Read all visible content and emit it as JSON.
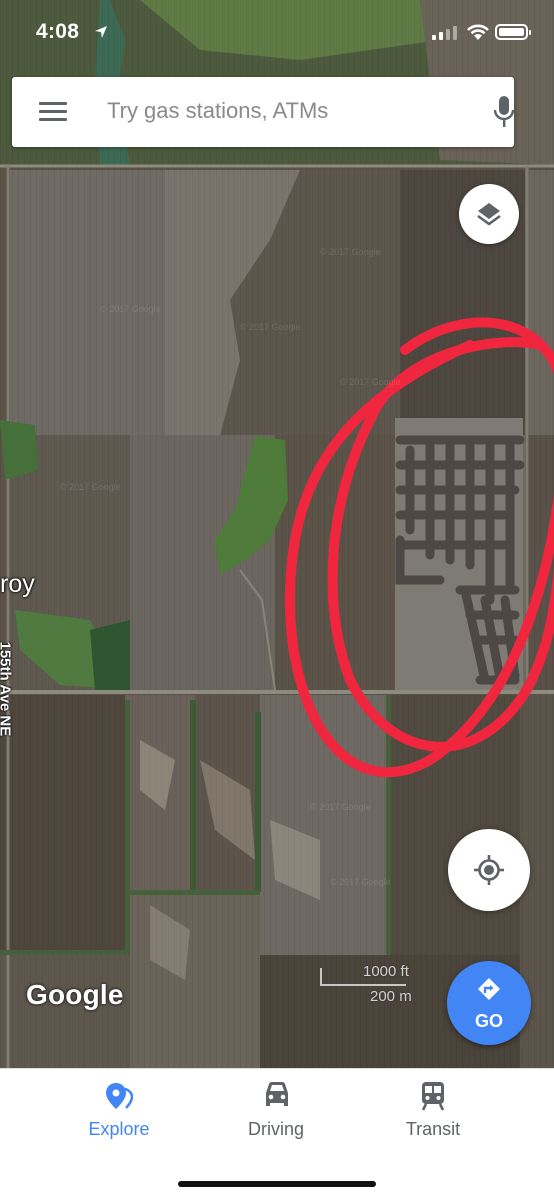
{
  "status_bar": {
    "time": "4:08"
  },
  "search": {
    "placeholder": "Try gas stations, ATMs"
  },
  "map": {
    "place_label": "roy",
    "street_label": "155th Ave NE",
    "attribution": "Google",
    "scale_imperial": "1000 ft",
    "scale_metric": "200 m",
    "annotation_color": "#f0263f"
  },
  "buttons": {
    "go_label": "GO"
  },
  "bottom_nav": {
    "tabs": [
      {
        "label": "Explore",
        "active": true
      },
      {
        "label": "Driving",
        "active": false
      },
      {
        "label": "Transit",
        "active": false
      }
    ]
  },
  "colors": {
    "accent": "#4285f4",
    "inactive": "#5f6368"
  }
}
